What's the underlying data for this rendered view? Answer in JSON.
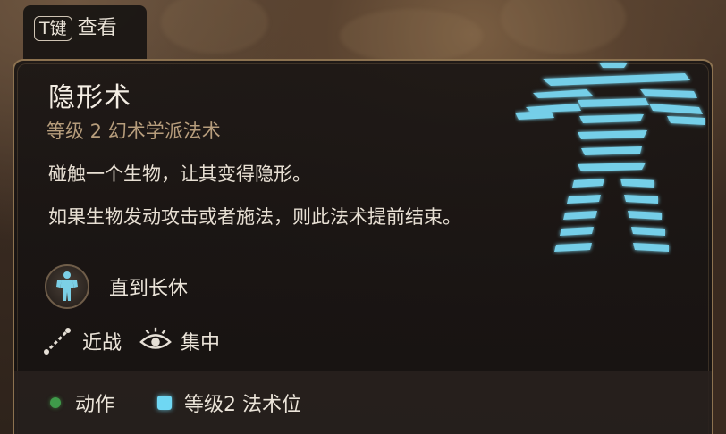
{
  "hotkey": {
    "key": "T键",
    "label": "查看"
  },
  "spell": {
    "name": "隐形术",
    "subtitle": "等级 2 幻术学派法术",
    "description_1": "碰触一个生物，让其变得隐形。",
    "description_2": "如果生物发动攻击或者施法，则此法术提前结束。",
    "duration": "直到长休",
    "range": "近战",
    "concentration": "集中",
    "art_icon": "invisible-figure-icon"
  },
  "footer": {
    "action_label": "动作",
    "slot_label": "等级2 法术位",
    "action_color": "#3f9a4a",
    "slot_color": "#6fd7f3"
  },
  "colors": {
    "panel_border": "#8c7250",
    "subtitle": "#b79d7c",
    "spell_glow": "#7fe3ff"
  }
}
